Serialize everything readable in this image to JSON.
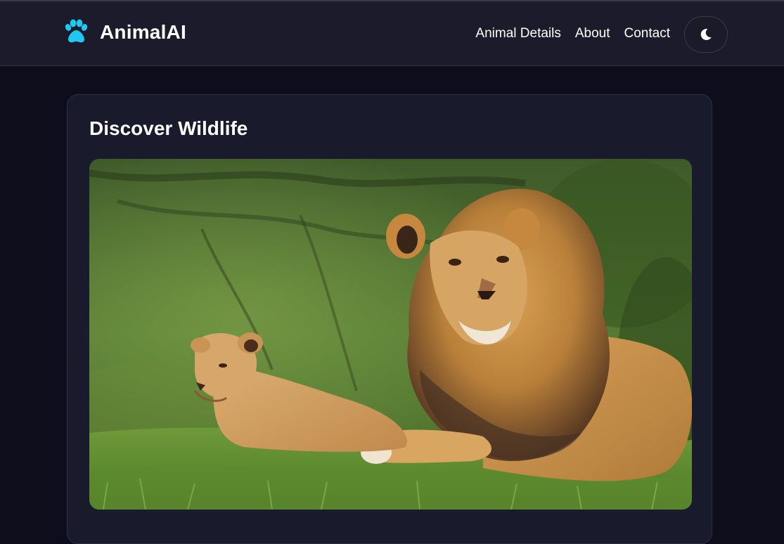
{
  "header": {
    "brand": "AnimalAI",
    "brand_icon": "paw-icon",
    "nav": [
      "Animal Details",
      "About",
      "Contact"
    ],
    "theme_toggle_icon": "moon-icon"
  },
  "main": {
    "title": "Discover Wildlife",
    "image_subject": "lion-and-cub-photo"
  },
  "colors": {
    "accent": "#1ec8f0",
    "background": "#0d0d1b",
    "surface": "#191a2b"
  }
}
